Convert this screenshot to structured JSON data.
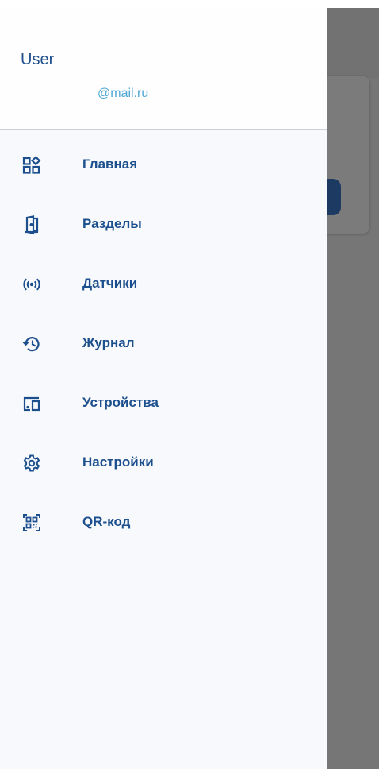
{
  "user": {
    "name": "User",
    "email": "@mail.ru"
  },
  "menu": {
    "items": [
      {
        "label": "Главная",
        "icon": "dashboard-icon"
      },
      {
        "label": "Разделы",
        "icon": "door-open-icon"
      },
      {
        "label": "Датчики",
        "icon": "sensor-signal-icon"
      },
      {
        "label": "Журнал",
        "icon": "history-icon"
      },
      {
        "label": "Устройства",
        "icon": "devices-icon"
      },
      {
        "label": "Настройки",
        "icon": "gear-icon"
      },
      {
        "label": "QR-код",
        "icon": "qr-code-icon"
      }
    ]
  },
  "colors": {
    "accent": "#1c4f8e",
    "email": "#4fa7d6",
    "drawer_bg": "#f8f9fc",
    "scrim": "#767676",
    "background_button": "#1d3a63"
  }
}
